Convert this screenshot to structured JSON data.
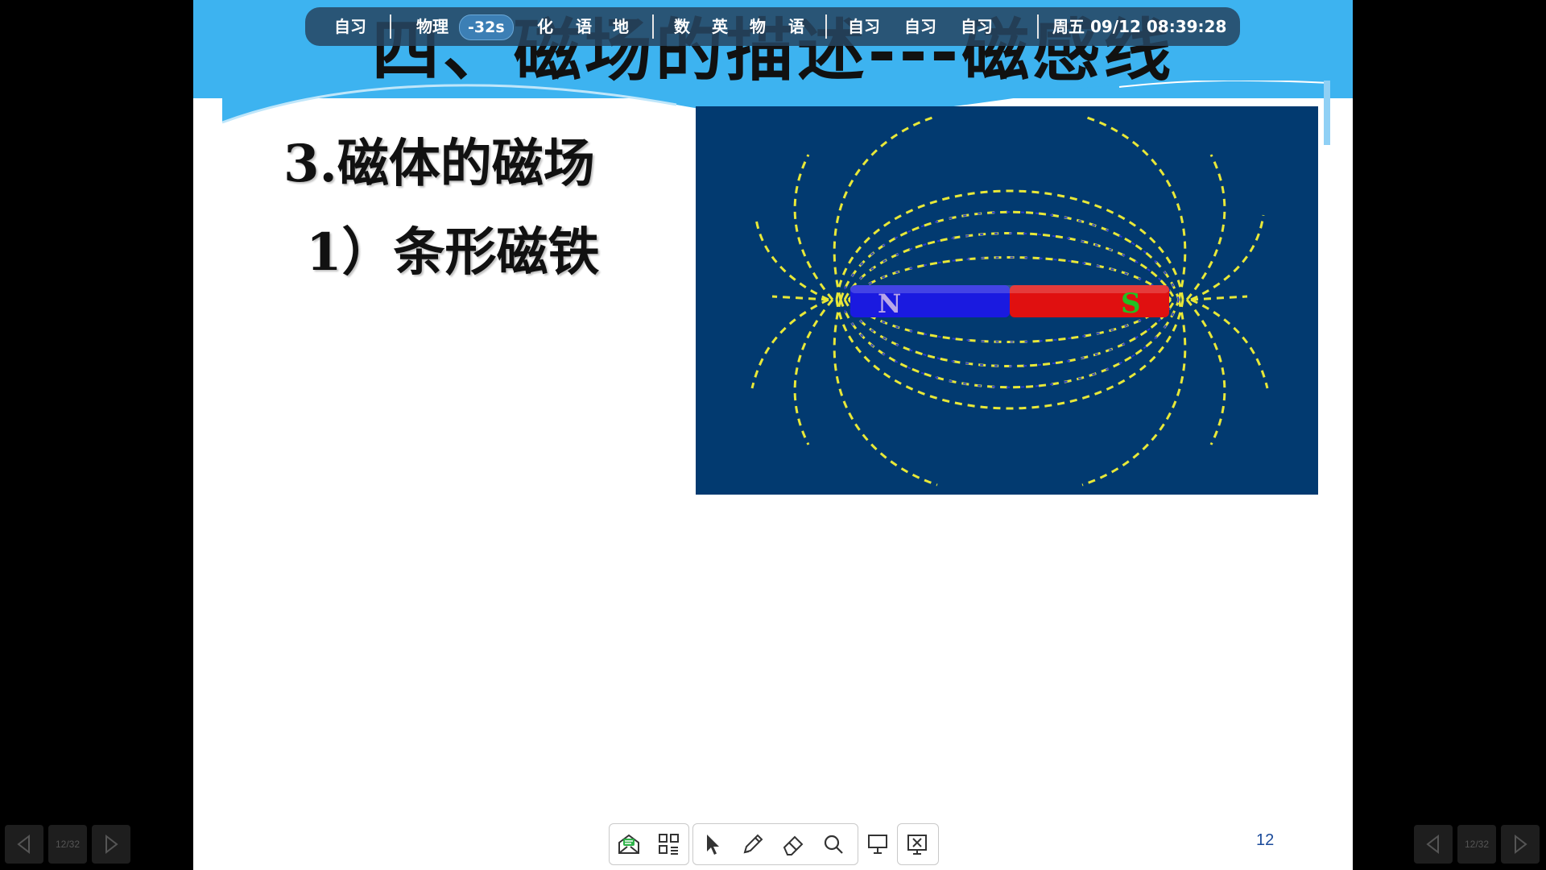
{
  "slide": {
    "title": "四、磁场的描述---磁感线",
    "heading_1": "3.磁体的磁场",
    "heading_2": "1）条形磁铁",
    "magnet": {
      "north_label": "N",
      "south_label": "S"
    },
    "page_number": "12"
  },
  "schedule_bar": {
    "items": [
      "自习",
      "物理",
      "化",
      "语",
      "地",
      "数",
      "英",
      "物",
      "语",
      "自习",
      "自习",
      "自习"
    ],
    "countdown": "-32s",
    "datetime": "周五 09/12  08:39:28"
  },
  "toolbar": {
    "icons": [
      "message-icon",
      "apps-grid-icon",
      "pointer-icon",
      "pen-icon",
      "eraser-icon",
      "search-icon",
      "whiteboard-icon",
      "exit-presentation-icon"
    ]
  },
  "page_nav": {
    "left": {
      "page_indicator": "12/32"
    },
    "right": {
      "page_indicator": "12/32"
    }
  },
  "colors": {
    "header_band": "#3db3f0",
    "figure_background": "#023a70",
    "magnet_north": "#1a1ae0",
    "magnet_south": "#e01010",
    "field_lines": "#e8e838"
  }
}
